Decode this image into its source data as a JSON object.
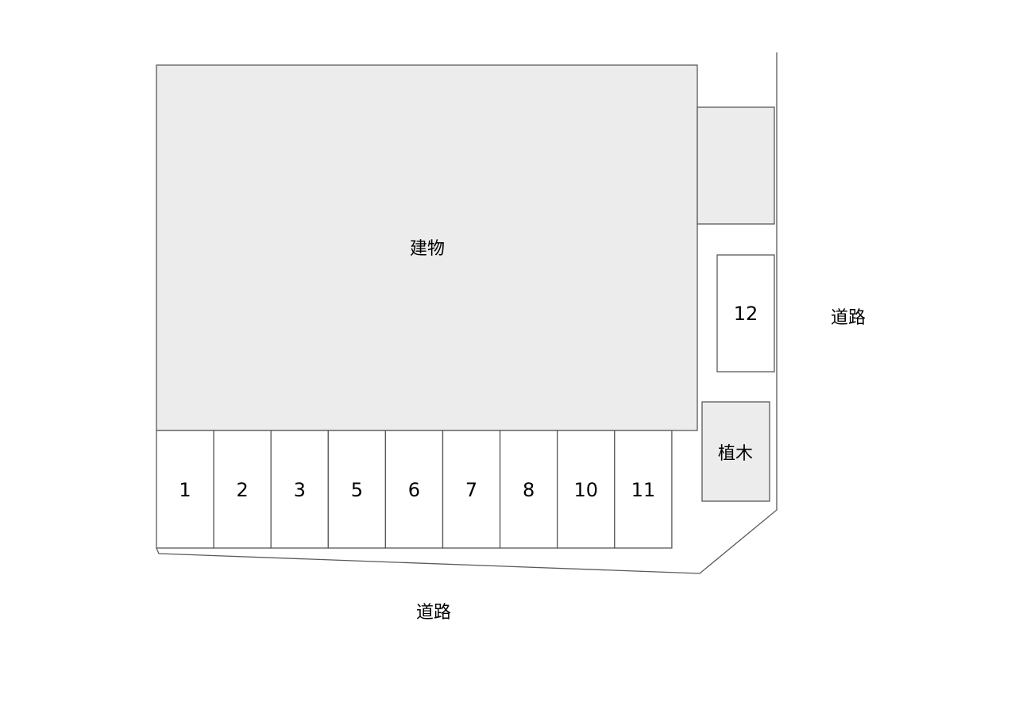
{
  "building": {
    "label": "建物"
  },
  "planting": {
    "label": "植木"
  },
  "roads": {
    "right": "道路",
    "bottom": "道路"
  },
  "stalls": [
    "1",
    "2",
    "3",
    "5",
    "6",
    "7",
    "8",
    "10",
    "11"
  ],
  "side_stall": "12",
  "colors": {
    "fill_gray": "#ececec",
    "stroke": "#595959"
  }
}
